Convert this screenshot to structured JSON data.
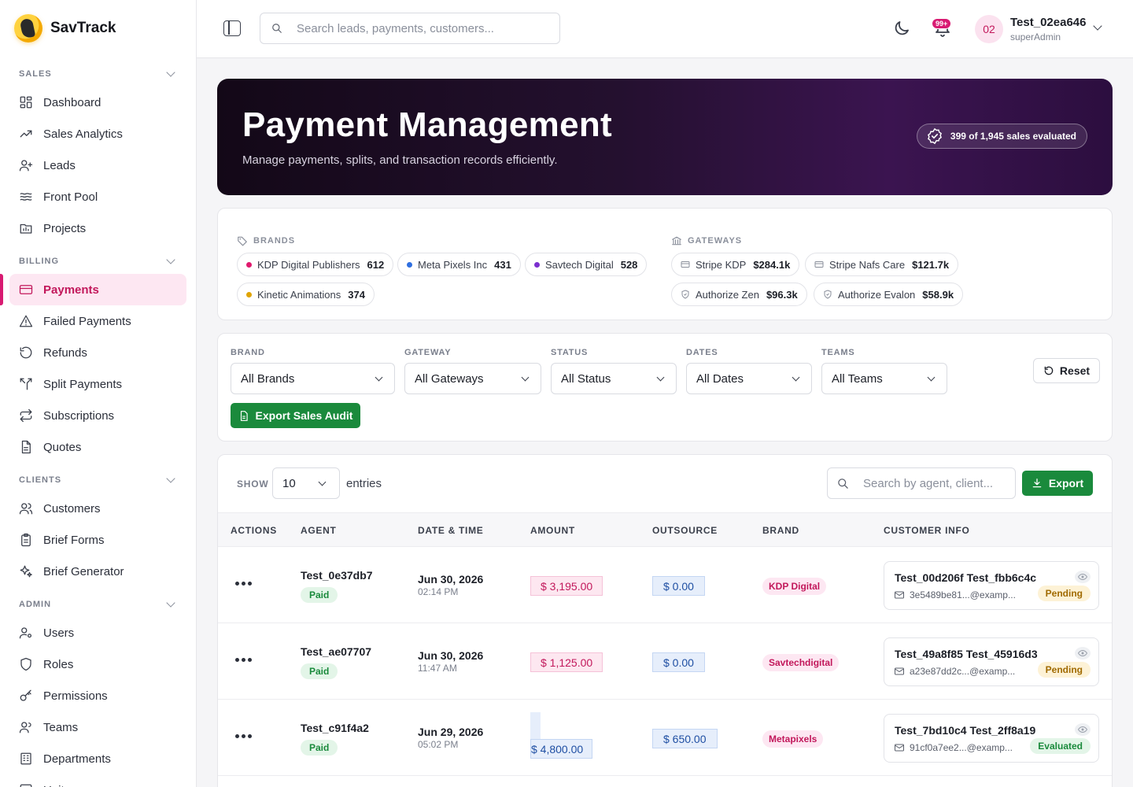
{
  "app": {
    "name": "SavTrack"
  },
  "sidebar": {
    "sections": [
      {
        "title": "SALES",
        "items": [
          {
            "label": "Dashboard",
            "icon": "dashboard-icon"
          },
          {
            "label": "Sales Analytics",
            "icon": "trend-icon"
          },
          {
            "label": "Leads",
            "icon": "user-plus-icon"
          },
          {
            "label": "Front Pool",
            "icon": "waves-icon"
          },
          {
            "label": "Projects",
            "icon": "folder-chart-icon"
          }
        ]
      },
      {
        "title": "BILLING",
        "items": [
          {
            "label": "Payments",
            "icon": "card-icon",
            "active": true
          },
          {
            "label": "Failed Payments",
            "icon": "warning-icon"
          },
          {
            "label": "Refunds",
            "icon": "refund-icon"
          },
          {
            "label": "Split Payments",
            "icon": "split-icon"
          },
          {
            "label": "Subscriptions",
            "icon": "repeat-icon"
          },
          {
            "label": "Quotes",
            "icon": "document-icon"
          }
        ]
      },
      {
        "title": "CLIENTS",
        "items": [
          {
            "label": "Customers",
            "icon": "users-icon"
          },
          {
            "label": "Brief Forms",
            "icon": "clipboard-icon"
          },
          {
            "label": "Brief Generator",
            "icon": "sparkles-icon"
          }
        ]
      },
      {
        "title": "ADMIN",
        "items": [
          {
            "label": "Users",
            "icon": "user-gear-icon"
          },
          {
            "label": "Roles",
            "icon": "shield-icon"
          },
          {
            "label": "Permissions",
            "icon": "key-icon"
          },
          {
            "label": "Teams",
            "icon": "team-icon"
          },
          {
            "label": "Departments",
            "icon": "building-icon"
          },
          {
            "label": "Units",
            "icon": "unit-icon"
          }
        ]
      }
    ]
  },
  "header": {
    "search_placeholder": "Search leads, payments, customers...",
    "notifications_badge": "99+",
    "user": {
      "initials": "02",
      "name": "Test_02ea646",
      "role": "superAdmin"
    }
  },
  "hero": {
    "title": "Payment Management",
    "subtitle": "Manage payments, splits, and transaction records efficiently.",
    "pill": "399 of 1,945 sales evaluated"
  },
  "brands": {
    "label": "BRANDS",
    "items": [
      {
        "name": "KDP Digital Publishers",
        "count": "612",
        "color": "#e0196e"
      },
      {
        "name": "Meta Pixels Inc",
        "count": "431",
        "color": "#2f6fe0"
      },
      {
        "name": "Savtech Digital",
        "count": "528",
        "color": "#7b2fcf"
      },
      {
        "name": "Kinetic Animations",
        "count": "374",
        "color": "#e0a400"
      }
    ]
  },
  "gateways": {
    "label": "GATEWAYS",
    "items": [
      {
        "name": "Stripe KDP",
        "amount": "$284.1k",
        "icon": "card-icon"
      },
      {
        "name": "Stripe Nafs Care",
        "amount": "$121.7k",
        "icon": "card-icon"
      },
      {
        "name": "Authorize Zen",
        "amount": "$96.3k",
        "icon": "shield-icon"
      },
      {
        "name": "Authorize Evalon",
        "amount": "$58.9k",
        "icon": "shield-icon"
      }
    ]
  },
  "filters": {
    "brand": {
      "label": "BRAND",
      "value": "All Brands"
    },
    "gateway": {
      "label": "GATEWAY",
      "value": "All Gateways"
    },
    "status": {
      "label": "STATUS",
      "value": "All Status"
    },
    "dates": {
      "label": "DATES",
      "value": "All Dates"
    },
    "teams": {
      "label": "TEAMS",
      "value": "All Teams"
    },
    "reset_label": "Reset",
    "export_audit_label": "Export Sales Audit"
  },
  "table": {
    "show_label": "SHOW",
    "entries_value": "10",
    "entries_label": "entries",
    "search_placeholder": "Search by agent, client...",
    "export_label": "Export",
    "columns": [
      "ACTIONS",
      "AGENT",
      "DATE & TIME",
      "AMOUNT",
      "OUTSOURCE",
      "BRAND",
      "CUSTOMER INFO"
    ],
    "rows": [
      {
        "agent": "Test_0e37db7",
        "payment_status": "Paid",
        "date": "Jun 30, 2026",
        "time": "02:14 PM",
        "amount": "$ 3,195.00",
        "outsource": "$ 0.00",
        "brand": "KDP Digital",
        "customer": "Test_00d206f Test_fbb6c4c",
        "email": "3e5489be81...@examp...",
        "status": "Pending"
      },
      {
        "agent": "Test_ae07707",
        "payment_status": "Paid",
        "date": "Jun 30, 2026",
        "time": "11:47 AM",
        "amount": "$ 1,125.00",
        "outsource": "$ 0.00",
        "brand": "Savtechdigital",
        "customer": "Test_49a8f85 Test_45916d3",
        "email": "a23e87dd2c...@examp...",
        "status": "Pending"
      },
      {
        "agent": "Test_c91f4a2",
        "payment_status": "Paid",
        "date": "Jun 29, 2026",
        "time": "05:02 PM",
        "amount": "$ 4,800.00",
        "outsource": "$ 650.00",
        "brand": "Metapixels",
        "customer": "Test_7bd10c4 Test_2ff8a19",
        "email": "91cf0a7ee2...@examp...",
        "status": "Evaluated"
      }
    ]
  }
}
